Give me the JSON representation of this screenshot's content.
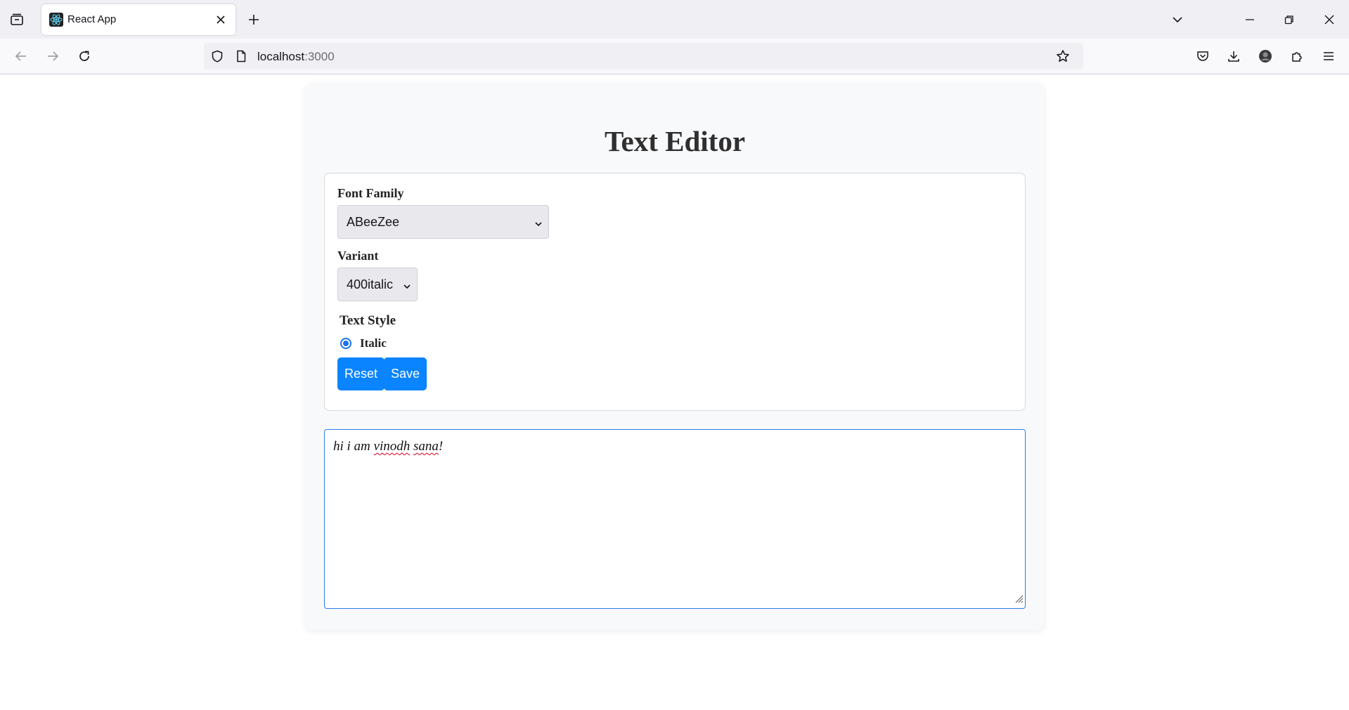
{
  "browser": {
    "tab_title": "React App",
    "url_host": "localhost",
    "url_port": ":3000",
    "icons": [
      "tab-list-icon",
      "react-logo-icon",
      "close-icon",
      "new-tab-icon",
      "list-all-tabs-icon",
      "minimize-icon",
      "restore-icon",
      "window-close-icon",
      "back-icon",
      "forward-icon",
      "reload-icon",
      "shield-icon",
      "page-icon",
      "star-icon",
      "pocket-icon",
      "download-icon",
      "account-icon",
      "extensions-icon",
      "menu-icon"
    ]
  },
  "app": {
    "title": "Text Editor",
    "font_family_label": "Font Family",
    "font_family_value": "ABeeZee",
    "variant_label": "Variant",
    "variant_value": "400italic",
    "text_style_label": "Text Style",
    "italic_label": "Italic",
    "italic_checked": true,
    "reset_label": "Reset",
    "save_label": "Save",
    "editor": {
      "prefix": "hi i am ",
      "word1": "vinodh",
      "space": " ",
      "word2": "sana",
      "suffix": "!"
    }
  },
  "colors": {
    "accent": "#0a84ff",
    "focus_border": "#2b7de9",
    "tab_strip": "#f0f0f4",
    "card_bg": "#f8f9fb"
  }
}
